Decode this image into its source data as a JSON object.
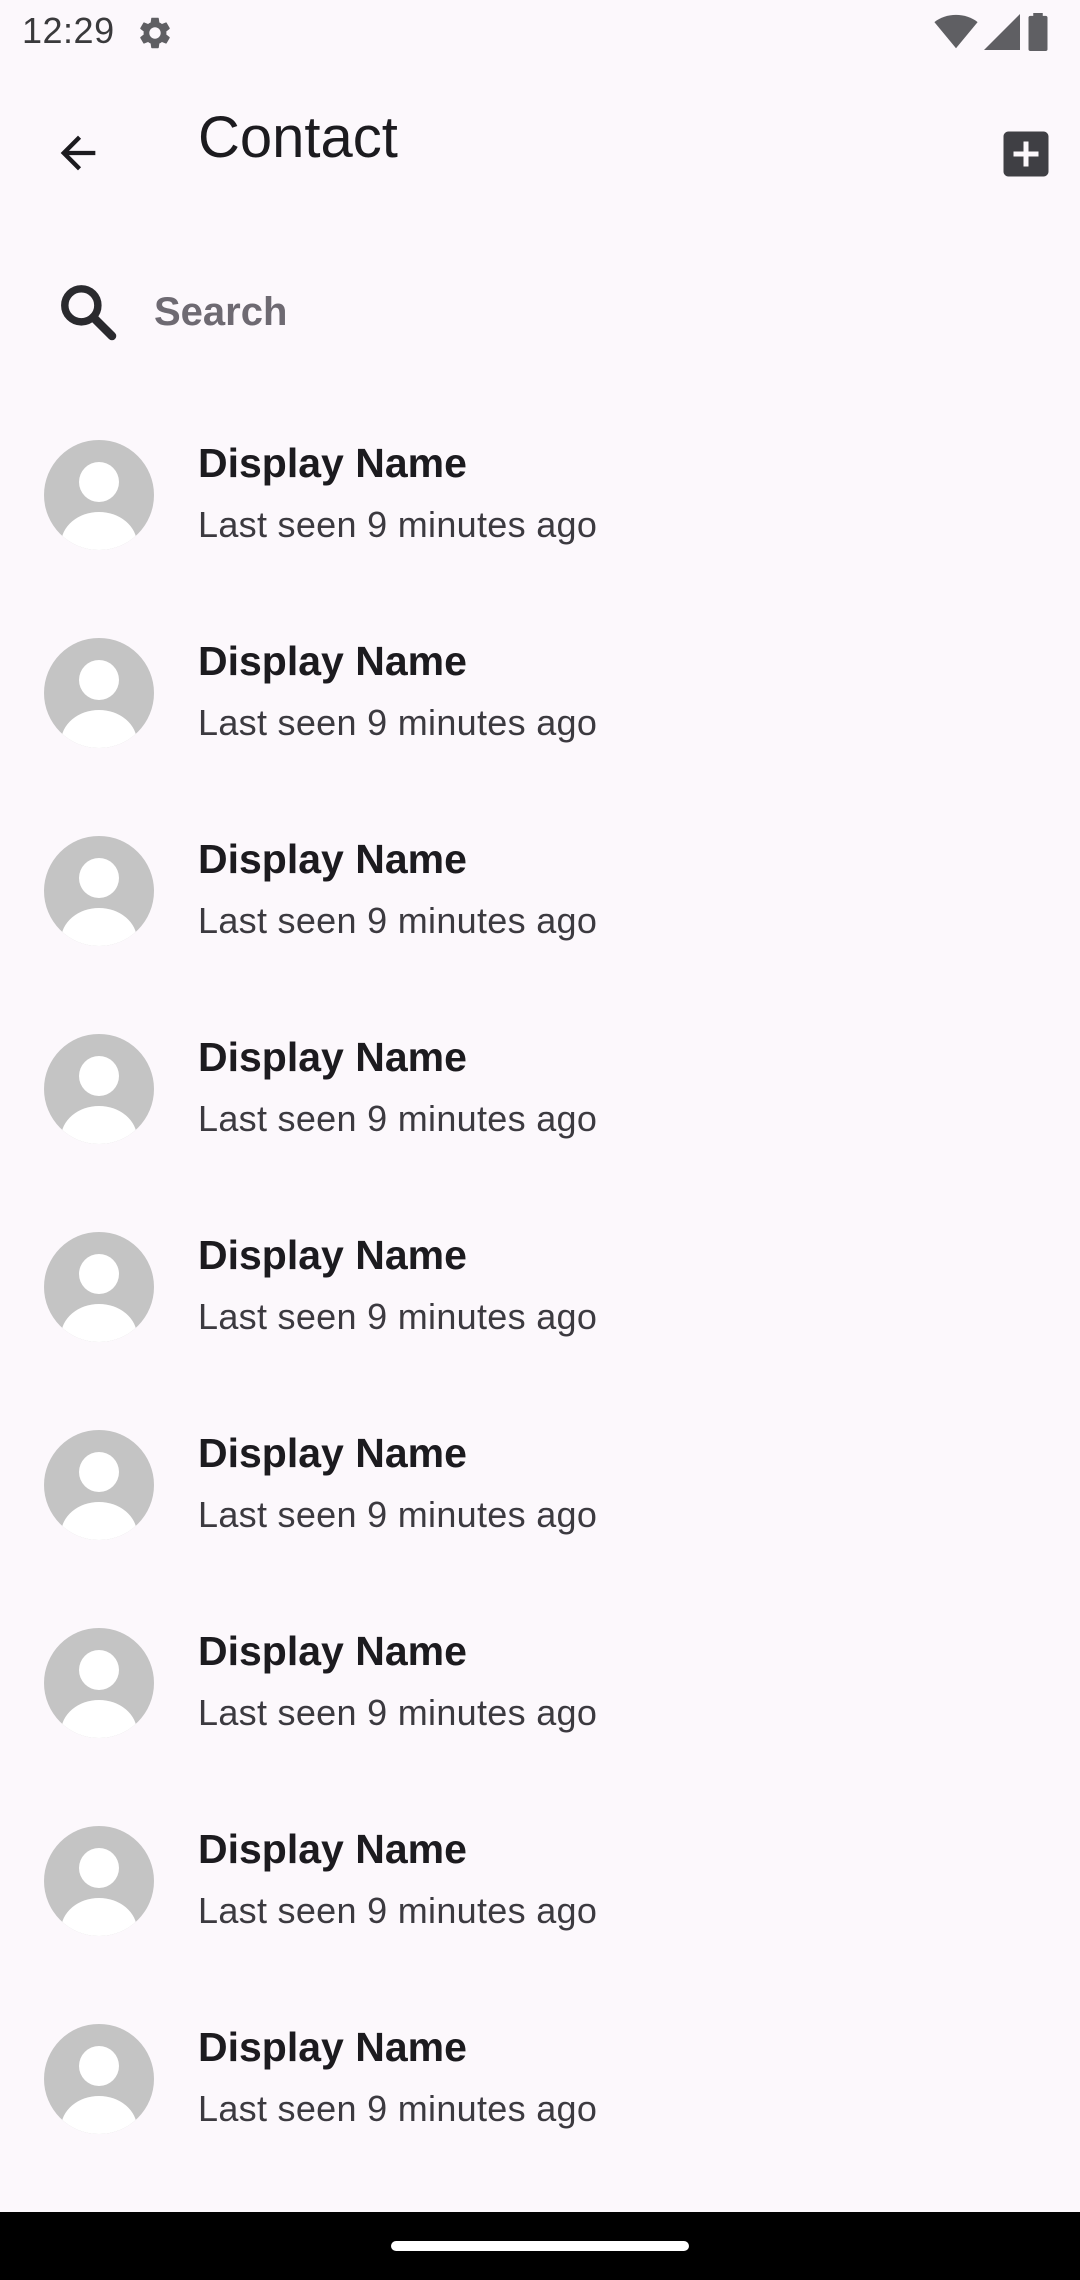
{
  "status_bar": {
    "time": "12:29",
    "settings_icon": "gear-icon",
    "wifi_icon": "wifi-icon",
    "signal_icon": "cellular-signal-icon",
    "battery_icon": "battery-icon"
  },
  "app_bar": {
    "back_icon": "arrow-back-icon",
    "title": "Contact",
    "add_icon": "add-box-icon"
  },
  "search": {
    "icon": "search-icon",
    "placeholder": "Search",
    "value": ""
  },
  "contacts": [
    {
      "name": "Display Name",
      "status": "Last seen 9 minutes ago"
    },
    {
      "name": "Display Name",
      "status": "Last seen 9 minutes ago"
    },
    {
      "name": "Display Name",
      "status": "Last seen 9 minutes ago"
    },
    {
      "name": "Display Name",
      "status": "Last seen 9 minutes ago"
    },
    {
      "name": "Display Name",
      "status": "Last seen 9 minutes ago"
    },
    {
      "name": "Display Name",
      "status": "Last seen 9 minutes ago"
    },
    {
      "name": "Display Name",
      "status": "Last seen 9 minutes ago"
    },
    {
      "name": "Display Name",
      "status": "Last seen 9 minutes ago"
    },
    {
      "name": "Display Name",
      "status": "Last seen 9 minutes ago"
    }
  ],
  "colors": {
    "background": "#fcf8fc",
    "avatar": "#c4c4c4",
    "text_primary": "#1c1b1f",
    "nav_bar": "#000000"
  }
}
